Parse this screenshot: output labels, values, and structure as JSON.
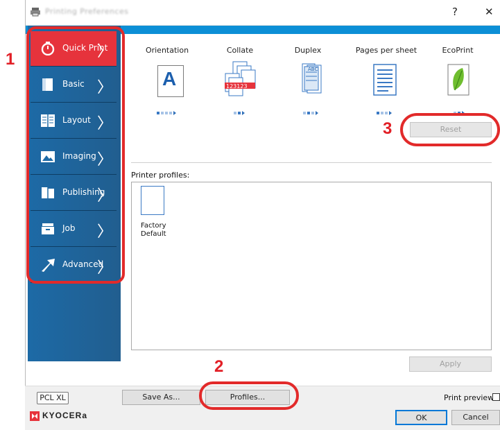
{
  "window": {
    "title": "Printing Preferences",
    "help_label": "?",
    "close_label": "✕"
  },
  "callouts": {
    "one": "1",
    "two": "2",
    "three": "3"
  },
  "sidebar": {
    "items": [
      {
        "label": "Quick Print",
        "icon": "stopwatch-icon"
      },
      {
        "label": "Basic",
        "icon": "page-icon"
      },
      {
        "label": "Layout",
        "icon": "layout-icon"
      },
      {
        "label": "Imaging",
        "icon": "image-icon"
      },
      {
        "label": "Publishing",
        "icon": "book-icon"
      },
      {
        "label": "Job",
        "icon": "tray-icon"
      },
      {
        "label": "Advanced",
        "icon": "arrow-icon"
      }
    ],
    "active_color": "#e6333c",
    "chevron": "〉"
  },
  "quick": {
    "columns": [
      {
        "label": "Orientation",
        "icon": "portrait-a-icon"
      },
      {
        "label": "Collate",
        "icon": "collate-icon"
      },
      {
        "label": "Duplex",
        "icon": "duplex-icon"
      },
      {
        "label": "Pages per sheet",
        "icon": "pages-per-sheet-icon"
      },
      {
        "label": "EcoPrint",
        "icon": "leaf-icon"
      }
    ],
    "orientation_letter": "A",
    "collate_sample": "123123",
    "duplex_letters": "ABC",
    "reset_label": "Reset"
  },
  "profiles": {
    "heading": "Printer profiles:",
    "items": [
      {
        "label_line1": "Factory",
        "label_line2": "Default"
      }
    ],
    "apply_label": "Apply"
  },
  "footer": {
    "pcl_label": "PCL XL",
    "save_as_label": "Save As...",
    "profiles_label": "Profiles...",
    "print_preview_label": "Print preview",
    "ok_label": "OK",
    "cancel_label": "Cancel",
    "brand": "KYOCERa"
  },
  "colors": {
    "accent_blue": "#0c8fd6",
    "sidebar_blue": "#1d6aa6",
    "callout_red": "#e21f26"
  }
}
